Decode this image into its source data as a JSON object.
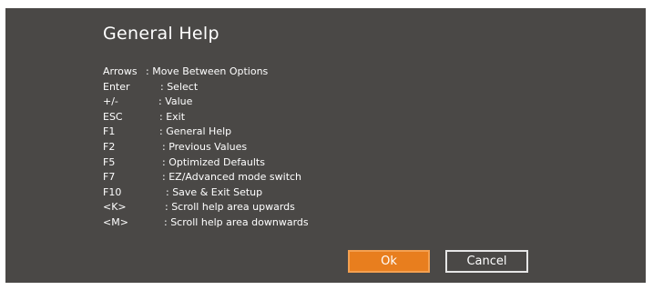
{
  "dialog": {
    "title": "General Help",
    "shortcuts": [
      {
        "key": "Arrows",
        "desc": ": Move Between Options"
      },
      {
        "key": "Enter",
        "desc": ": Select"
      },
      {
        "key": "+/-",
        "desc": ": Value"
      },
      {
        "key": "ESC",
        "desc": ": Exit"
      },
      {
        "key": "F1",
        "desc": ": General Help"
      },
      {
        "key": "F2",
        "desc": ": Previous Values"
      },
      {
        "key": "F5",
        "desc": ": Optimized Defaults"
      },
      {
        "key": "F7",
        "desc": ": EZ/Advanced mode switch"
      },
      {
        "key": "F10",
        "desc": ": Save & Exit Setup"
      },
      {
        "key": "<K>",
        "desc": ": Scroll help area upwards"
      },
      {
        "key": "<M>",
        "desc": ": Scroll help area downwards"
      }
    ],
    "ok_label": "Ok",
    "cancel_label": "Cancel"
  },
  "colors": {
    "dialog_background": "#4a4846",
    "accent": "#e87e1e",
    "text": "#ffffff"
  }
}
